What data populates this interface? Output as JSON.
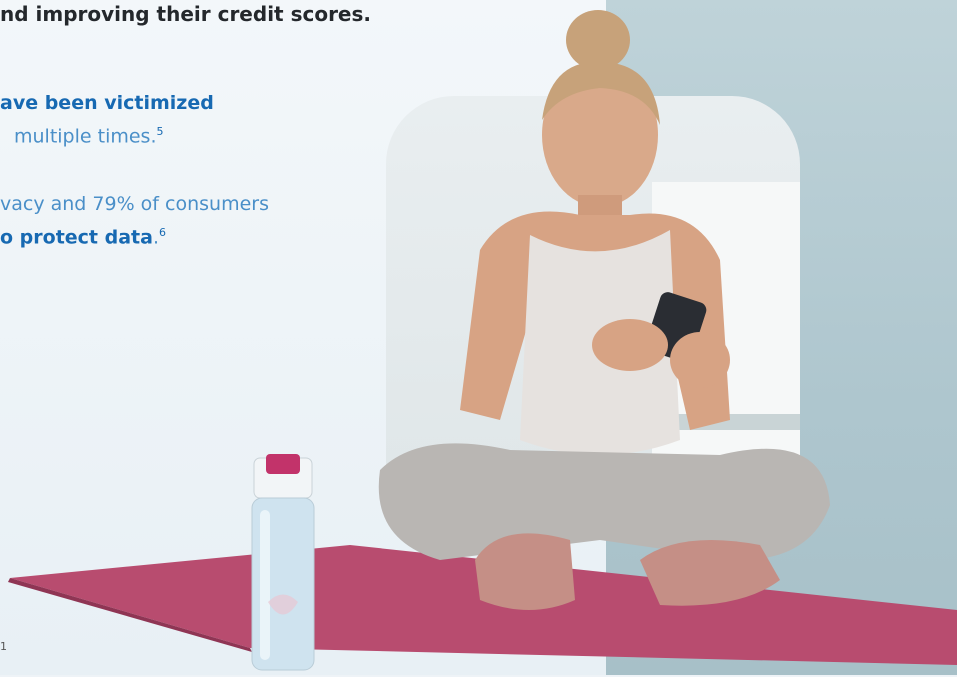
{
  "text": {
    "headline": "nd improving their credit scores.",
    "line1_bold": "ave been victimized",
    "line2": "multiple times.",
    "line2_ref": "5",
    "line3": "vacy and 79% of consumers",
    "line4_bold": "o protect data",
    "line4_end": ".",
    "line4_ref": "6",
    "footnote": "1"
  },
  "colors": {
    "accent": "#1769b2",
    "light_accent": "#2f83c4",
    "headline": "#24282c",
    "mat": "#b84c6f",
    "right_panel": "#aec6ce"
  }
}
